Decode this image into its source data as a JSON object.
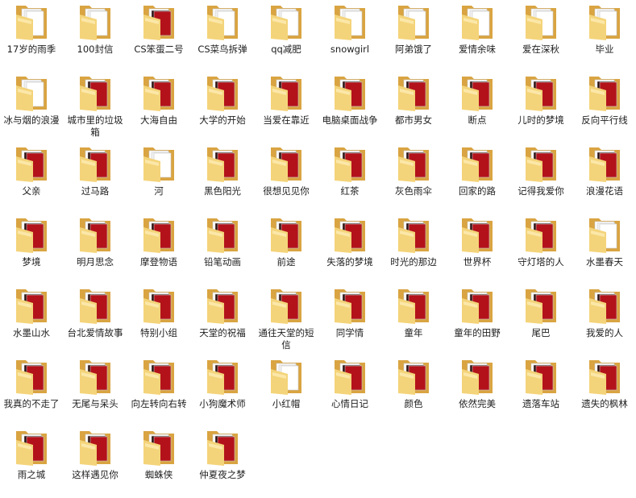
{
  "colors": {
    "folder_back": "#d9a441",
    "folder_front": "#f4d47a",
    "folder_front_light": "#fbe7a8",
    "paper": "#ffffff",
    "paper_red": "#b3121b",
    "paper_dark": "#2a0d0d"
  },
  "folders": [
    {
      "label": "17岁的雨季",
      "style": "white"
    },
    {
      "label": "100封信",
      "style": "white"
    },
    {
      "label": "CS笨蛋二号",
      "style": "red"
    },
    {
      "label": "CS菜鸟拆弹",
      "style": "white"
    },
    {
      "label": "qq减肥",
      "style": "white"
    },
    {
      "label": "snowgirl",
      "style": "white"
    },
    {
      "label": "阿弟饿了",
      "style": "white"
    },
    {
      "label": "爱情余味",
      "style": "white"
    },
    {
      "label": "爱在深秋",
      "style": "white"
    },
    {
      "label": "毕业",
      "style": "white"
    },
    {
      "label": "冰与烟的浪漫",
      "style": "white"
    },
    {
      "label": "城市里的垃圾箱",
      "style": "red"
    },
    {
      "label": "大海自由",
      "style": "red"
    },
    {
      "label": "大学的开始",
      "style": "red"
    },
    {
      "label": "当爱在靠近",
      "style": "red"
    },
    {
      "label": "电脑桌面战争",
      "style": "red"
    },
    {
      "label": "都市男女",
      "style": "red"
    },
    {
      "label": "断点",
      "style": "red"
    },
    {
      "label": "儿时的梦境",
      "style": "red"
    },
    {
      "label": "反向平行线",
      "style": "red"
    },
    {
      "label": "父亲",
      "style": "red"
    },
    {
      "label": "过马路",
      "style": "red"
    },
    {
      "label": "河",
      "style": "white"
    },
    {
      "label": "黑色阳光",
      "style": "red"
    },
    {
      "label": "很想见见你",
      "style": "red"
    },
    {
      "label": "红茶",
      "style": "red"
    },
    {
      "label": "灰色雨伞",
      "style": "red"
    },
    {
      "label": "回家的路",
      "style": "red"
    },
    {
      "label": "记得我爱你",
      "style": "red"
    },
    {
      "label": "浪漫花语",
      "style": "red"
    },
    {
      "label": "梦境",
      "style": "red"
    },
    {
      "label": "明月思念",
      "style": "red"
    },
    {
      "label": "摩登物语",
      "style": "red"
    },
    {
      "label": "铅笔动画",
      "style": "red"
    },
    {
      "label": "前途",
      "style": "red"
    },
    {
      "label": "失落的梦境",
      "style": "red"
    },
    {
      "label": "时光的那边",
      "style": "red"
    },
    {
      "label": "世界杯",
      "style": "red"
    },
    {
      "label": "守灯塔的人",
      "style": "red"
    },
    {
      "label": "水墨春天",
      "style": "white"
    },
    {
      "label": "水墨山水",
      "style": "red"
    },
    {
      "label": "台北爱情故事",
      "style": "red"
    },
    {
      "label": "特别小组",
      "style": "red"
    },
    {
      "label": "天堂的祝福",
      "style": "red"
    },
    {
      "label": "通往天堂的短信",
      "style": "red"
    },
    {
      "label": "同学情",
      "style": "red"
    },
    {
      "label": "童年",
      "style": "red"
    },
    {
      "label": "童年的田野",
      "style": "red"
    },
    {
      "label": "尾巴",
      "style": "red"
    },
    {
      "label": "我爱的人",
      "style": "red"
    },
    {
      "label": "我真的不走了",
      "style": "red"
    },
    {
      "label": "无尾与呆头",
      "style": "red"
    },
    {
      "label": "向左转向右转",
      "style": "red"
    },
    {
      "label": "小狗魔术师",
      "style": "red"
    },
    {
      "label": "小红帽",
      "style": "white"
    },
    {
      "label": "心情日记",
      "style": "red"
    },
    {
      "label": "颜色",
      "style": "red"
    },
    {
      "label": "依然完美",
      "style": "red"
    },
    {
      "label": "遗落车站",
      "style": "red"
    },
    {
      "label": "遗失的枫林",
      "style": "red"
    },
    {
      "label": "雨之城",
      "style": "red"
    },
    {
      "label": "这样遇见你",
      "style": "red"
    },
    {
      "label": "蜘蛛侠",
      "style": "red"
    },
    {
      "label": "仲夏夜之梦",
      "style": "red"
    }
  ]
}
